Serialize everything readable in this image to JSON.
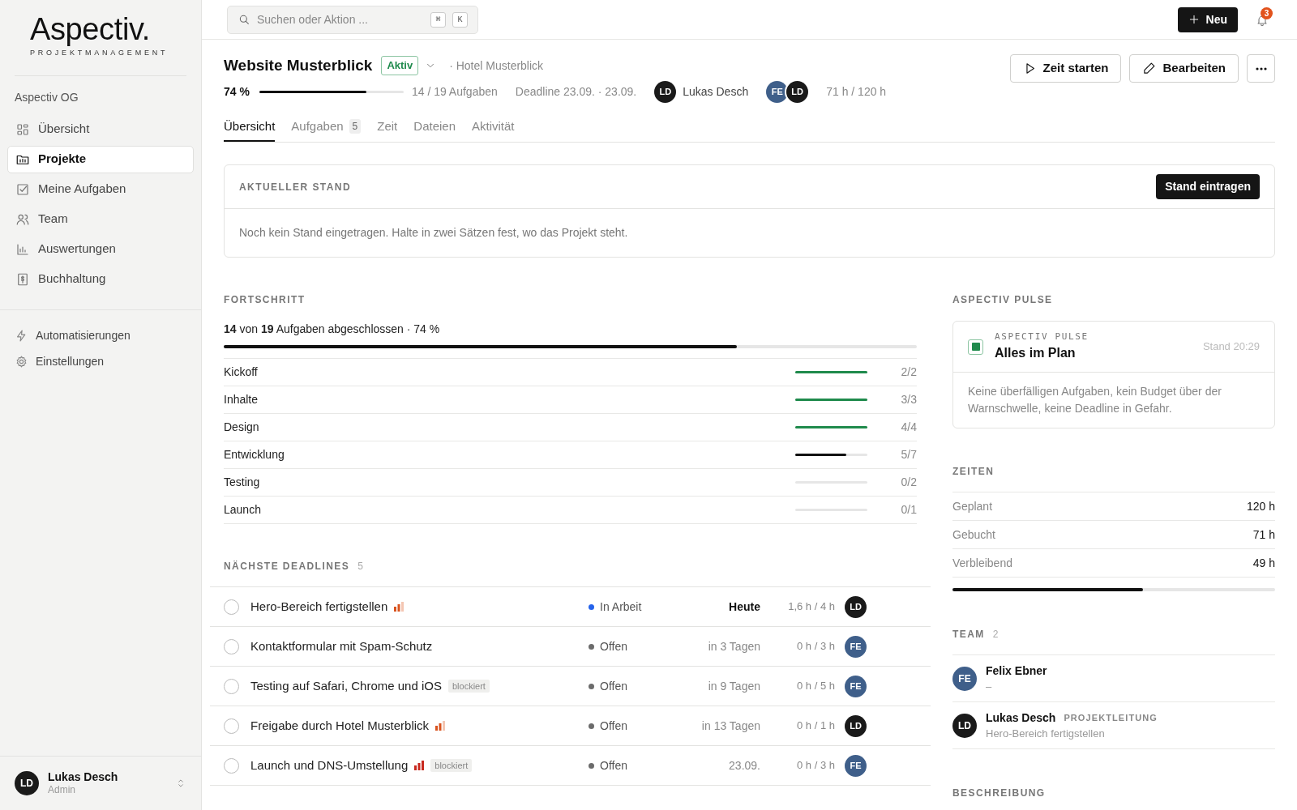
{
  "logo": {
    "name": "Aspectiv.",
    "tagline": "PROJEKTMANAGEMENT"
  },
  "sidebar": {
    "org": "Aspectiv OG",
    "items": [
      {
        "label": "Übersicht",
        "selected": false
      },
      {
        "label": "Projekte",
        "selected": true
      },
      {
        "label": "Meine Aufgaben",
        "selected": false
      },
      {
        "label": "Team",
        "selected": false
      },
      {
        "label": "Auswertungen",
        "selected": false
      },
      {
        "label": "Buchhaltung",
        "selected": false
      }
    ],
    "secondary": [
      {
        "label": "Automatisierungen",
        "selected": false
      },
      {
        "label": "Einstellungen",
        "selected": false
      }
    ],
    "user": {
      "initials": "LD",
      "name": "Lukas Desch",
      "role": "Admin"
    }
  },
  "topbar": {
    "search": {
      "placeholder": "Suchen oder Aktion ...",
      "keys": [
        "⌘",
        "K"
      ]
    },
    "new_button": "Neu",
    "notifications": "3"
  },
  "project": {
    "title": "Website Musterblick",
    "status": "Aktiv",
    "client": "· Hotel Musterblick",
    "percent": "74 %",
    "level": 0.74,
    "tasks": "14 / 19 Aufgaben",
    "deadline": "Deadline 23.09. · 23.09.",
    "lead": {
      "initials": "LD",
      "name": "Lukas Desch",
      "color": "#1a1a1a"
    },
    "members": [
      {
        "initials": "FE",
        "color": "#3f5f8a"
      },
      {
        "initials": "LD",
        "color": "#1a1a1a"
      }
    ],
    "hours": "71 h / 120 h",
    "actions": [
      "Zeit starten",
      "Bearbeiten"
    ]
  },
  "tabs": [
    {
      "label": "Übersicht",
      "selected": true
    },
    {
      "label": "Aufgaben",
      "count": "5",
      "selected": false
    },
    {
      "label": "Zeit",
      "selected": false
    },
    {
      "label": "Dateien",
      "selected": false
    },
    {
      "label": "Aktivität",
      "selected": false
    }
  ],
  "status_card": {
    "heading": "AKTUELLER STAND",
    "button": "Stand eintragen",
    "text": "Noch kein Stand eingetragen. Halte in zwei Sätzen fest, wo das Projekt steht."
  },
  "progress": {
    "heading": "FORTSCHRITT",
    "summary": "**14** von **19** Aufgaben abgeschlossen · 74 %",
    "level": 0.74,
    "phases": [
      {
        "name": "Kickoff",
        "count": "2/2",
        "level": 1,
        "color": "#1f8a4c"
      },
      {
        "name": "Inhalte",
        "count": "3/3",
        "level": 1,
        "color": "#1f8a4c"
      },
      {
        "name": "Design",
        "count": "4/4",
        "level": 1,
        "color": "#1f8a4c"
      },
      {
        "name": "Entwicklung",
        "count": "5/7",
        "level": 0.71,
        "color": "#111111"
      },
      {
        "name": "Testing",
        "count": "0/2",
        "level": 0
      },
      {
        "name": "Launch",
        "count": "0/1",
        "level": 0
      }
    ]
  },
  "deadlines": {
    "heading": "NÄCHSTE DEADLINES",
    "count": "5",
    "rows": [
      {
        "done": false,
        "title": "Hero-Bereich fertigstellen",
        "priority": {
          "kind": "medium"
        },
        "blocked": false,
        "status": "In Arbeit",
        "color": "#2563eb",
        "due": "Heute",
        "due_today": true,
        "time": "1,6 h / 4 h",
        "assignee": {
          "initials": "LD",
          "color": "#1a1a1a"
        }
      },
      {
        "done": false,
        "title": "Kontaktformular mit Spam-Schutz",
        "blocked": false,
        "status": "Offen",
        "color": "#6b6b6b",
        "due": "in 3 Tagen",
        "due_today": false,
        "time": "0 h / 3 h",
        "assignee": {
          "initials": "FE",
          "color": "#3f5f8a"
        }
      },
      {
        "done": false,
        "title": "Testing auf Safari, Chrome und iOS",
        "blocked": true,
        "blocked_label": "blockiert",
        "status": "Offen",
        "color": "#6b6b6b",
        "due": "in 9 Tagen",
        "due_today": false,
        "time": "0 h / 5 h",
        "assignee": {
          "initials": "FE",
          "color": "#3f5f8a"
        }
      },
      {
        "done": false,
        "title": "Freigabe durch Hotel Musterblick",
        "priority": {
          "kind": "medium"
        },
        "blocked": false,
        "status": "Offen",
        "color": "#6b6b6b",
        "due": "in 13 Tagen",
        "due_today": false,
        "time": "0 h / 1 h",
        "assignee": {
          "initials": "LD",
          "color": "#1a1a1a"
        }
      },
      {
        "done": false,
        "title": "Launch und DNS-Umstellung",
        "priority": {
          "kind": "high"
        },
        "blocked": true,
        "blocked_label": "blockiert",
        "status": "Offen",
        "color": "#6b6b6b",
        "due": "23.09.",
        "due_today": false,
        "time": "0 h / 3 h",
        "assignee": {
          "initials": "FE",
          "color": "#3f5f8a"
        }
      }
    ]
  },
  "pulse": {
    "heading": "ASPECTIV PULSE",
    "label": "ASPECTIV PULSE",
    "title": "Alles im Plan",
    "time": "Stand 20:29",
    "text": "Keine überfälligen Aufgaben, kein Budget über der Warnschwelle, keine Deadline in Gefahr."
  },
  "times": {
    "heading": "ZEITEN",
    "rows": [
      {
        "label": "Geplant",
        "value": "120 h"
      },
      {
        "label": "Gebucht",
        "value": "71 h"
      },
      {
        "label": "Verbleibend",
        "value": "49 h"
      }
    ],
    "level": 0.59
  },
  "team": {
    "heading": "TEAM",
    "count": "2",
    "members": [
      {
        "initials": "FE",
        "color": "#3f5f8a",
        "name": "Felix Ebner",
        "detail": "–"
      },
      {
        "initials": "LD",
        "color": "#1a1a1a",
        "name": "Lukas Desch",
        "role": "PROJEKTLEITUNG",
        "detail": "Hero-Bereich fertigstellen"
      }
    ]
  },
  "description": {
    "heading": "BESCHREIBUNG"
  }
}
